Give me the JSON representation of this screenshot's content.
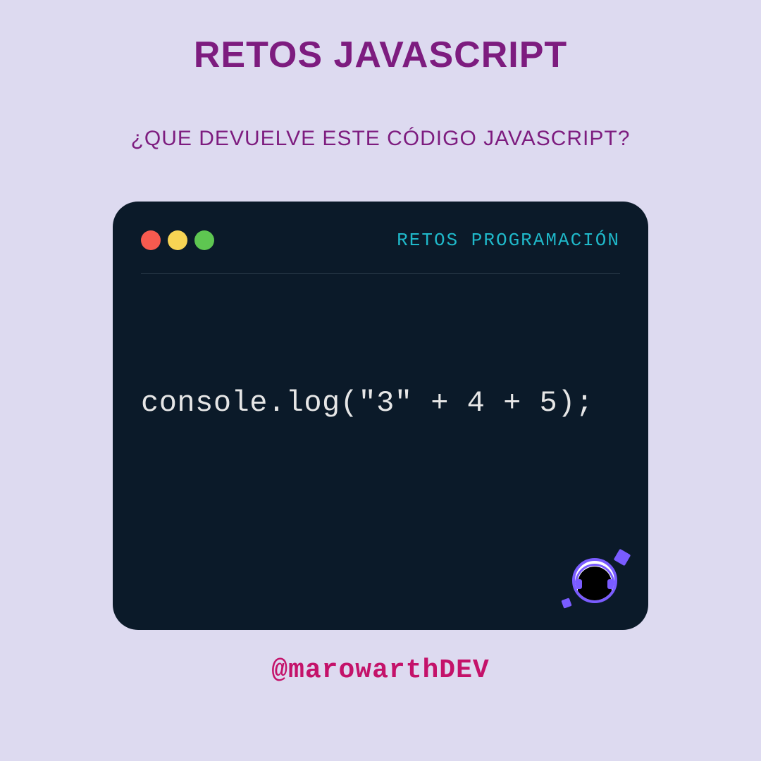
{
  "title": "RETOS JAVASCRIPT",
  "subtitle": "¿QUE DEVUELVE ESTE CÓDIGO JAVASCRIPT?",
  "window": {
    "label": "RETOS PROGRAMACIÓN",
    "code": "console.log(\"3\" + 4 + 5);"
  },
  "handle": "@marowarthDEV"
}
